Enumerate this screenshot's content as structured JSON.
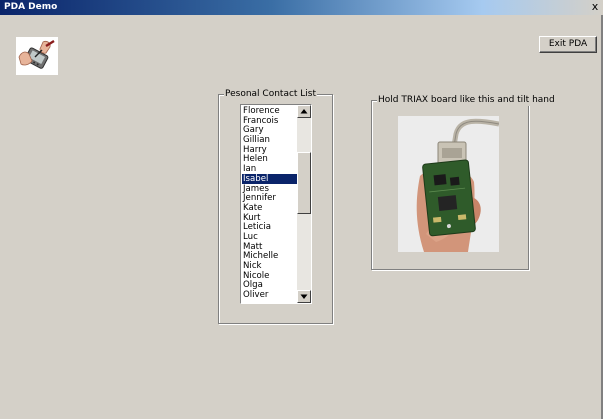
{
  "window": {
    "title": "PDA Demo",
    "close_label": "x"
  },
  "toolbar": {
    "exit_label": "Exit PDA"
  },
  "contacts": {
    "group_label": "Pesonal Contact List",
    "items": [
      "Florence",
      "Francois",
      "Gary",
      "Gillian",
      "Harry",
      "Helen",
      "Ian",
      "Isabel",
      "James",
      "Jennifer",
      "Kate",
      "Kurt",
      "Leticia",
      "Luc",
      "Matt",
      "Michelle",
      "Nick",
      "Nicole",
      "Olga",
      "Oliver"
    ],
    "selected": "Isabel"
  },
  "image_panel": {
    "group_label": "Hold TRIAX board like this and tilt hand"
  },
  "icons": {
    "logo": "pda-stylus-hand-icon",
    "scroll_up": "triangle-up-icon",
    "scroll_down": "triangle-down-icon"
  },
  "colors": {
    "titlebar_start": "#0a246a",
    "titlebar_end": "#a6caf0",
    "window_bg": "#d4d0c8",
    "selection_bg": "#0a246a",
    "selection_text": "#ffffff",
    "board_green": "#2f5b2a"
  }
}
